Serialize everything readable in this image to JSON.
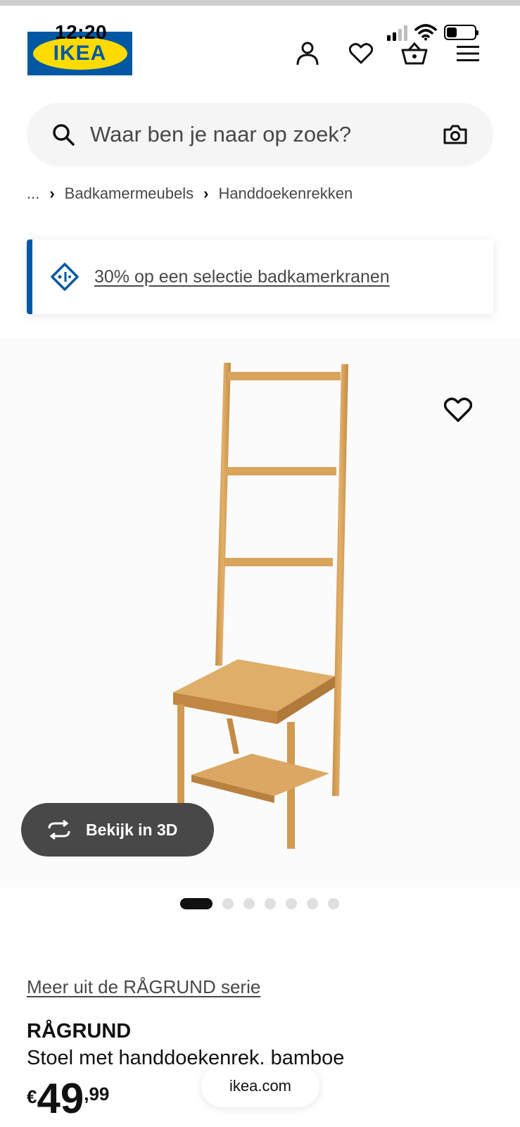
{
  "status_bar": {
    "time": "12:20"
  },
  "header": {
    "logo_text": "IKEA"
  },
  "search": {
    "placeholder": "Waar ben je naar op zoek?"
  },
  "breadcrumb": {
    "items": [
      "...",
      "Badkamermeubels",
      "Handdoekenrekken"
    ]
  },
  "promo": {
    "text": "30% op een selectie badkamerkranen"
  },
  "gallery": {
    "view_3d_label": "Bekijk in 3D",
    "image_count": 7,
    "active_index": 0
  },
  "product": {
    "series_link": "Meer uit de RÅGRUND serie",
    "name": "RÅGRUND",
    "description": "Stoel met handdoekenrek. bamboe",
    "price_currency": "€",
    "price_integer": "49",
    "price_decimal": ",99"
  },
  "browser": {
    "url": "ikea.com"
  },
  "colors": {
    "brand_blue": "#0058a3",
    "brand_yellow": "#ffdb00",
    "bamboo": "#d9a55c"
  }
}
